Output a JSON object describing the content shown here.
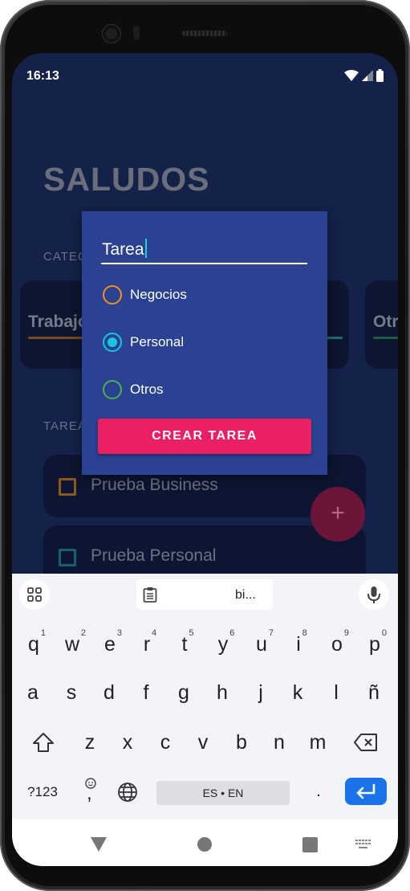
{
  "status": {
    "time": "16:13"
  },
  "app": {
    "title": "SALUDOS",
    "categories_label": "CATEGORÍAS",
    "tasks_label": "TAREAS"
  },
  "categories": [
    {
      "name": "Trabajo",
      "color": "#ef8a1a"
    },
    {
      "name": "Otros",
      "color": "#2ea27a"
    }
  ],
  "category_peek": {
    "color": "#22b7a7"
  },
  "tasks": [
    {
      "text": "Prueba Business",
      "color": "#ef8a1a"
    },
    {
      "text": "Prueba Personal",
      "color": "#138a92"
    }
  ],
  "fab": {
    "icon": "plus-icon",
    "label": "+"
  },
  "dialog": {
    "input_value": "Tarea",
    "options": [
      {
        "label": "Negocios",
        "color": "#f2901c",
        "selected": false
      },
      {
        "label": "Personal",
        "color": "#1ac6df",
        "selected": true
      },
      {
        "label": "Otros",
        "color": "#4caf50",
        "selected": false
      }
    ],
    "button_label": "CREAR TAREA"
  },
  "keyboard": {
    "clipboard_preview": "bi...",
    "row1": [
      {
        "k": "q",
        "n": "1"
      },
      {
        "k": "w",
        "n": "2"
      },
      {
        "k": "e",
        "n": "3"
      },
      {
        "k": "r",
        "n": "4"
      },
      {
        "k": "t",
        "n": "5"
      },
      {
        "k": "y",
        "n": "6"
      },
      {
        "k": "u",
        "n": "7"
      },
      {
        "k": "i",
        "n": "8"
      },
      {
        "k": "o",
        "n": "9"
      },
      {
        "k": "p",
        "n": "0"
      }
    ],
    "row2": [
      "a",
      "s",
      "d",
      "f",
      "g",
      "h",
      "j",
      "k",
      "l",
      "ñ"
    ],
    "row3": [
      "z",
      "x",
      "c",
      "v",
      "b",
      "n",
      "m"
    ],
    "symbols_label": "?123",
    "emoji_comma": ",",
    "space_label": "ES • EN",
    "period": "."
  }
}
